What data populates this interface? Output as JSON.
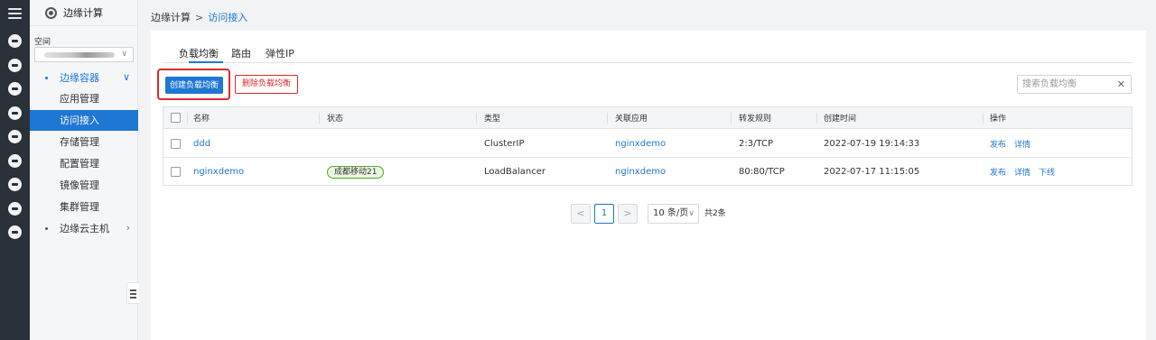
{
  "sidebar": {
    "title": "边缘计算",
    "space_label": "空间",
    "groups": [
      {
        "label": "边缘容器",
        "items": [
          "应用管理",
          "访问接入",
          "存储管理",
          "配置管理",
          "镜像管理",
          "集群管理"
        ]
      },
      {
        "label": "边缘云主机"
      }
    ]
  },
  "breadcrumb": {
    "parent": "边缘计算",
    "separator": ">",
    "current": "访问接入"
  },
  "tabs": [
    "负载均衡",
    "路由",
    "弹性IP"
  ],
  "toolbar": {
    "create_label": "创建负载均衡",
    "delete_label": "删除负载均衡",
    "search_placeholder": "搜索负载均衡"
  },
  "table": {
    "headers": [
      "名称",
      "状态",
      "类型",
      "关联应用",
      "转发规则",
      "创建时间",
      "操作"
    ],
    "rows": [
      {
        "name": "ddd",
        "status": "",
        "type": "ClusterIP",
        "app": "nginxdemo",
        "rule": "2:3/TCP",
        "created": "2022-07-19 19:14:33",
        "actions": [
          "发布",
          "详情"
        ]
      },
      {
        "name": "nginxdemo",
        "status": "成都移动21",
        "type": "LoadBalancer",
        "app": "nginxdemo",
        "rule": "80:80/TCP",
        "created": "2022-07-17 11:15:05",
        "actions": [
          "发布",
          "详情",
          "下线"
        ]
      }
    ]
  },
  "pagination": {
    "prev": "<",
    "page": "1",
    "next": ">",
    "page_size": "10 条/页",
    "total": "共2条"
  },
  "colors": {
    "accent": "#1e77d3",
    "danger": "#d92b2b",
    "rail": "#2b3138",
    "tag_green": "#5aa829"
  }
}
